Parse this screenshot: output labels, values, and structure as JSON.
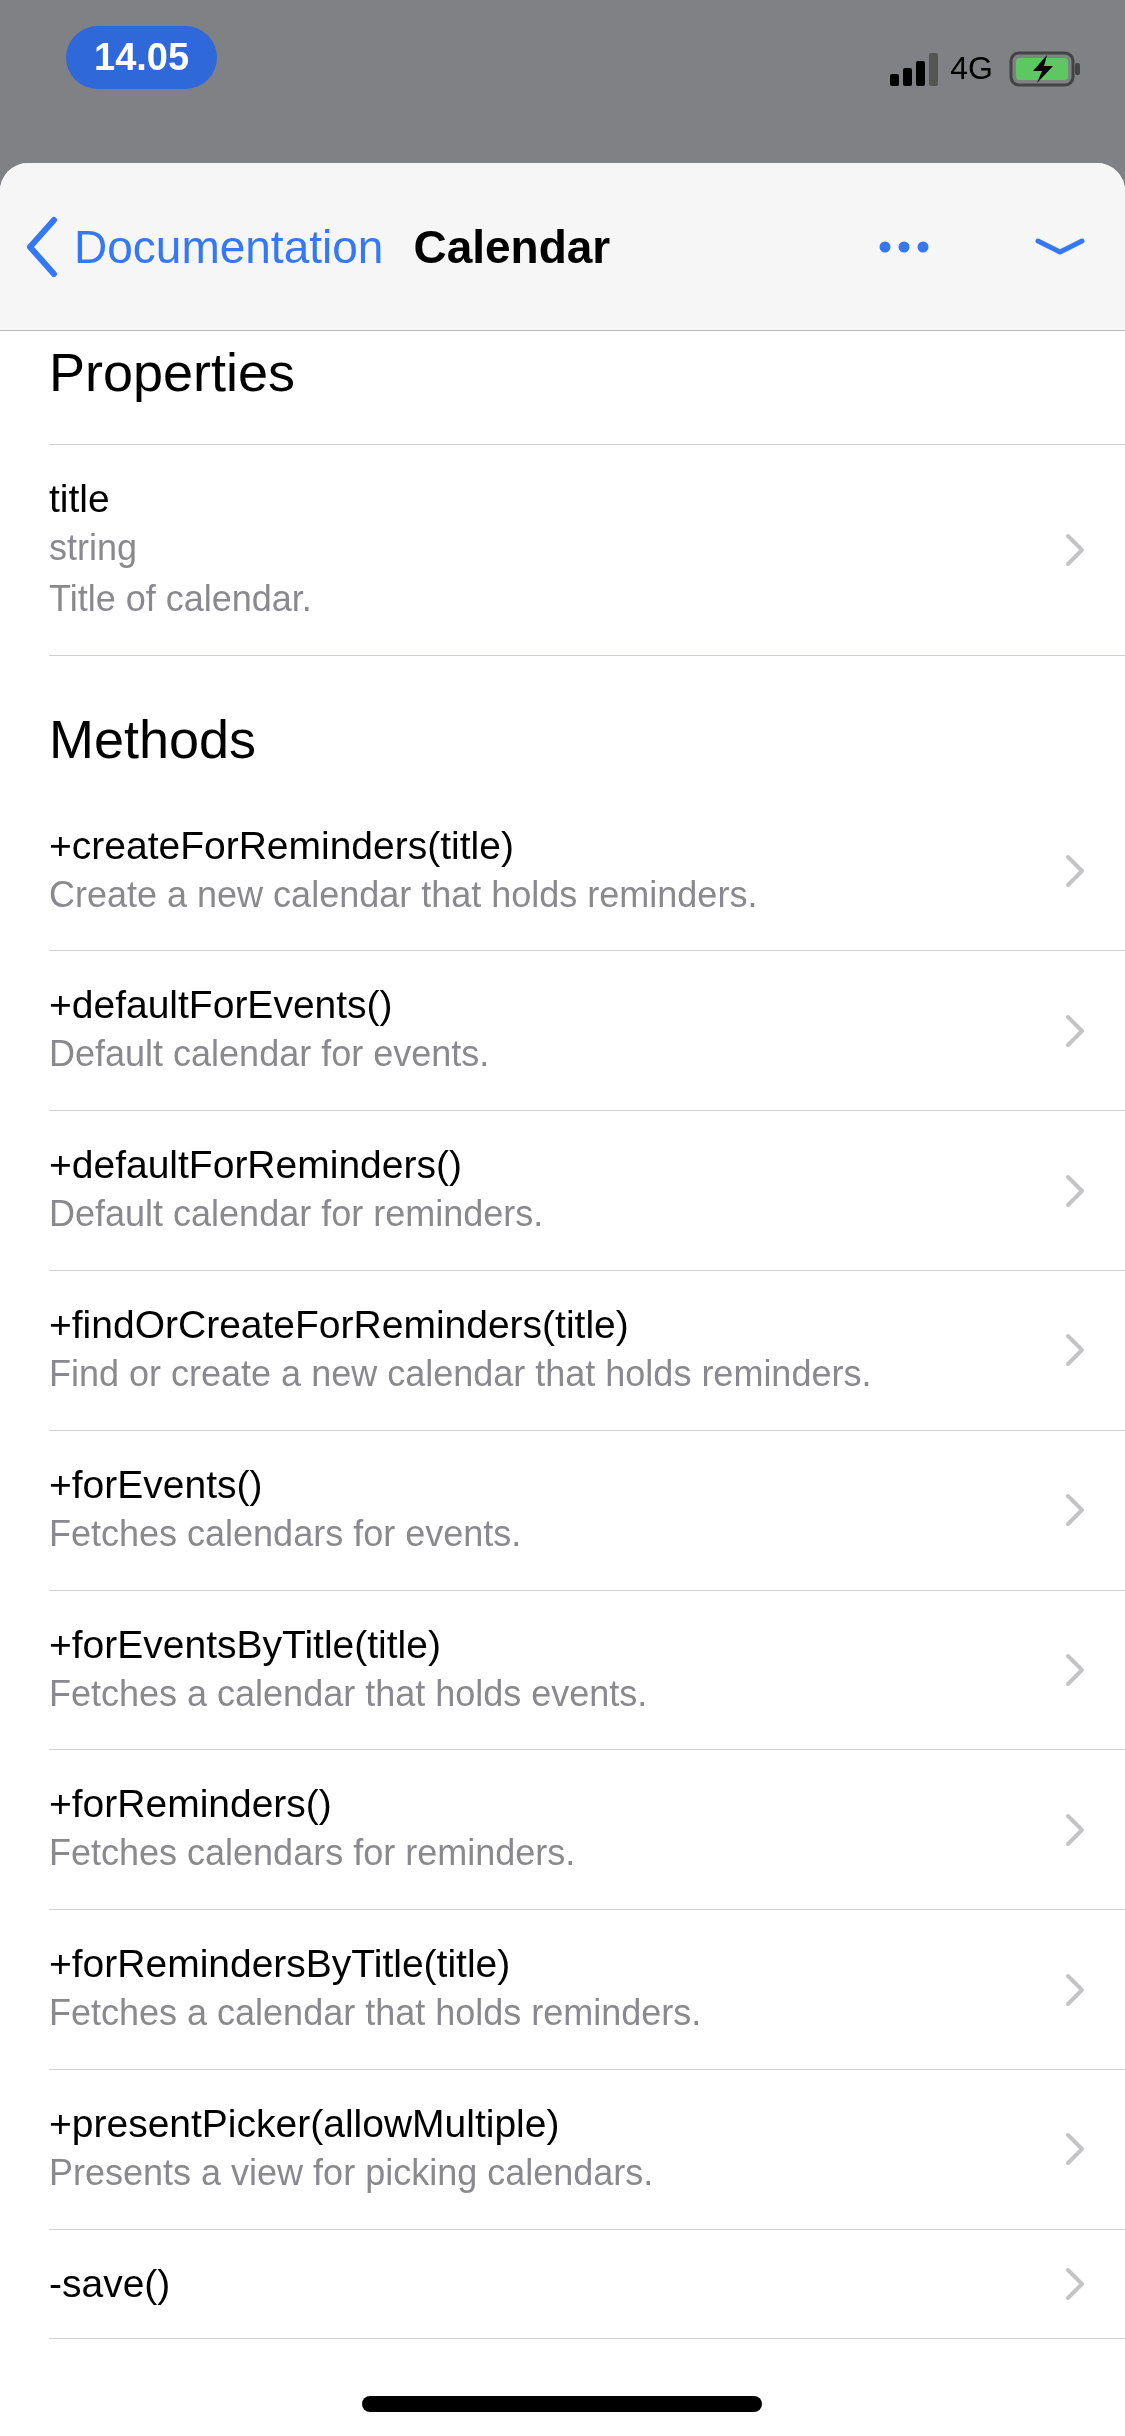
{
  "status_bar": {
    "time": "14.05",
    "network": "4G"
  },
  "nav": {
    "back": "Documentation",
    "title": "Calendar"
  },
  "sections": [
    {
      "heading": "Properties",
      "items": [
        {
          "name": "title",
          "type": "string",
          "description": "Title of calendar."
        }
      ]
    },
    {
      "heading": "Methods",
      "items": [
        {
          "name": "+createForReminders(title)",
          "description": "Create a new calendar that holds reminders."
        },
        {
          "name": "+defaultForEvents()",
          "description": "Default calendar for events."
        },
        {
          "name": "+defaultForReminders()",
          "description": "Default calendar for reminders."
        },
        {
          "name": "+findOrCreateForReminders(title)",
          "description": "Find or create a new calendar that holds reminders."
        },
        {
          "name": "+forEvents()",
          "description": "Fetches calendars for events."
        },
        {
          "name": "+forEventsByTitle(title)",
          "description": "Fetches a calendar that holds events."
        },
        {
          "name": "+forReminders()",
          "description": "Fetches calendars for reminders."
        },
        {
          "name": "+forRemindersByTitle(title)",
          "description": "Fetches a calendar that holds reminders."
        },
        {
          "name": "+presentPicker(allowMultiple)",
          "description": "Presents a view for picking calendars."
        },
        {
          "name": "-save()"
        }
      ]
    }
  ]
}
